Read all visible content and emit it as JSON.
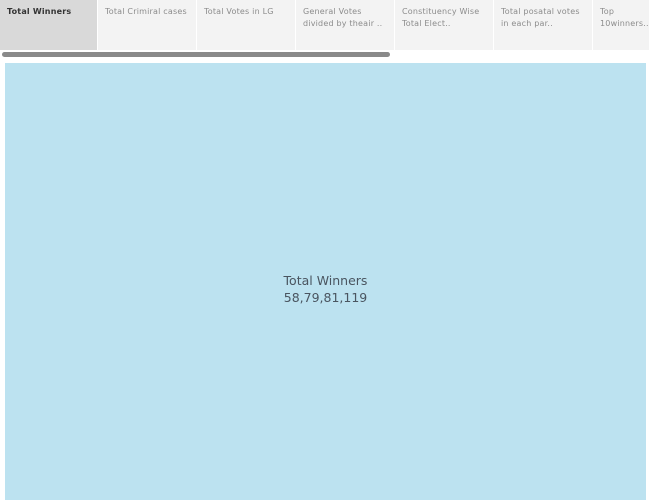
{
  "tabs": [
    {
      "label": "Total Winners",
      "active": true
    },
    {
      "label": "Total Crimiral cases",
      "active": false
    },
    {
      "label": "Total Votes in LG",
      "active": false
    },
    {
      "label": "General Votes divided by theair ..",
      "active": false
    },
    {
      "label": "Constituency Wise Total Elect..",
      "active": false
    },
    {
      "label": "Total posatal votes in each par..",
      "active": false
    },
    {
      "label": "Top 10winners..",
      "active": false
    }
  ],
  "treemap": {
    "color": "#bce2f0",
    "measure_label": "Total Winners",
    "value": "58,79,81,119"
  }
}
